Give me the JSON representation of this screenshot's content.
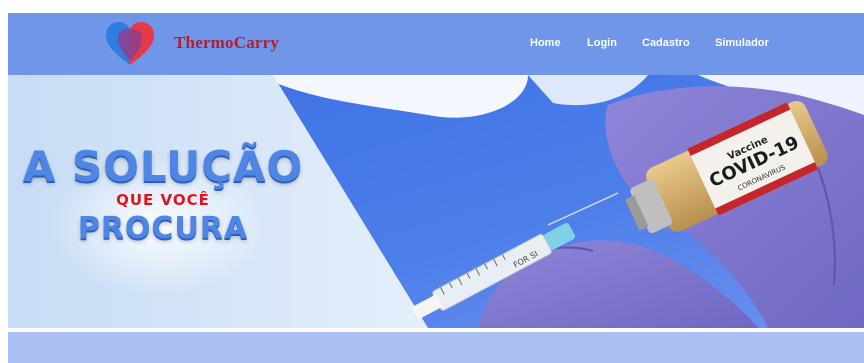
{
  "brand": {
    "name": "ThermoCarry"
  },
  "nav": {
    "items": [
      "Home",
      "Login",
      "Cadastro",
      "Simulador"
    ]
  },
  "hero": {
    "line1": "A SOLUÇÃO",
    "line2": "QUE VOCÊ",
    "line3": "PROCURA",
    "vial_label": "COVID-19",
    "vial_sub1": "Vaccine",
    "vial_sub2": "CORONAVIRUS",
    "syringe_text": "FOR SI"
  },
  "colors": {
    "navbar": "#6f96e8",
    "brand_text": "#b01f2e",
    "accent_red": "#e0141b",
    "headline_blue": "#4f86e6"
  }
}
